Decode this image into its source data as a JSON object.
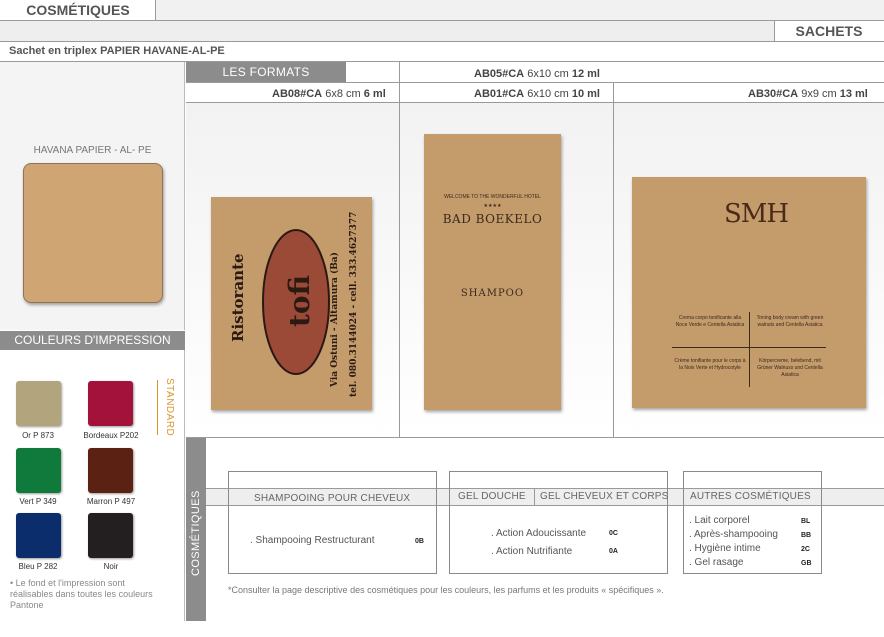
{
  "header": {
    "title": "COSMÉTIQUES",
    "section": "SACHETS",
    "product_line": "Sachet en triplex PAPIER HAVANE-AL-PE"
  },
  "formats": {
    "tab_label": "LES FORMATS",
    "items": [
      {
        "code": "AB08#CA",
        "size": "6x8 cm",
        "volume": "6 ml"
      },
      {
        "code": "AB05#CA",
        "size": "6x10 cm",
        "volume": "12 ml"
      },
      {
        "code": "AB01#CA",
        "size": "6x10 cm",
        "volume": "10 ml"
      },
      {
        "code": "AB30#CA",
        "size": "9x9 cm",
        "volume": "13 ml"
      }
    ]
  },
  "material": {
    "label": "HAVANA PAPIER - AL- PE"
  },
  "samples": {
    "ristorante": {
      "name": "Ristorante",
      "logo": "tofi",
      "address": "Via Ostuni - Altamura (Ba)",
      "phone": "tel. 080.3144024 - cell. 333.4627377"
    },
    "bad_boekelo": {
      "top_line": "WELCOME TO THE WONDERFUL HOTEL",
      "stars": "★★★★",
      "brand": "BAD BOEKELO",
      "product": "SHAMPOO"
    },
    "smh": {
      "logo": "SMH",
      "q1": "Crema corpo tonificante alla Noce Verde e Centella Asiatica",
      "q2": "Toning body cream with green walnuts and Centella Asiatica",
      "q3": "Crème tonifiante pour le corps à la Noix Verte et Hydrocotyle",
      "q4": "Körpercreme, belebend, mit Grüner Walnuss und Centella Asiatica"
    }
  },
  "print_colors": {
    "title": "COULEURS D'IMPRESSION",
    "standard_label": "STANDARD",
    "swatches": [
      {
        "label": "Or P 873",
        "color": "#b2a47c"
      },
      {
        "label": "Bordeaux P202",
        "color": "#a2123a"
      },
      {
        "label": "Vert P 349",
        "color": "#0f7a3c"
      },
      {
        "label": "Marron P 497",
        "color": "#5b2213"
      },
      {
        "label": "Bleu P 282",
        "color": "#0b2d6b"
      },
      {
        "label": "Noir",
        "color": "#231f20"
      }
    ],
    "note": "• Le fond et l'impression sont réalisables dans toutes les couleurs Pantone"
  },
  "cosmetics": {
    "side_label": "COSMÉTIQUES",
    "categories": [
      {
        "title": "SHAMPOOING POUR CHEVEUX",
        "items": [
          {
            "label": ". Shampooing Restructurant",
            "code": "0B"
          }
        ]
      },
      {
        "title": "GEL DOUCHE",
        "items": [
          {
            "label": ". Action Adoucissante",
            "code": "0C"
          },
          {
            "label": ". Action Nutrifiante",
            "code": "0A"
          }
        ]
      },
      {
        "title": "GEL CHEVEUX ET CORPS",
        "items": []
      },
      {
        "title": "AUTRES COSMÉTIQUES",
        "items": [
          {
            "label": ". Lait corporel",
            "code": "BL"
          },
          {
            "label": ". Après-shampooing",
            "code": "BB"
          },
          {
            "label": ". Hygiène intime",
            "code": "2C"
          },
          {
            "label": ". Gel rasage",
            "code": "GB"
          }
        ]
      }
    ],
    "footnote": "*Consulter la page descriptive des cosmétiques pour les couleurs, les parfums et les produits « spécifiques »."
  },
  "colors": {
    "kraft": "#c49b6b",
    "header_grey": "#8c8c8c",
    "standard_orange": "#d9962b"
  }
}
